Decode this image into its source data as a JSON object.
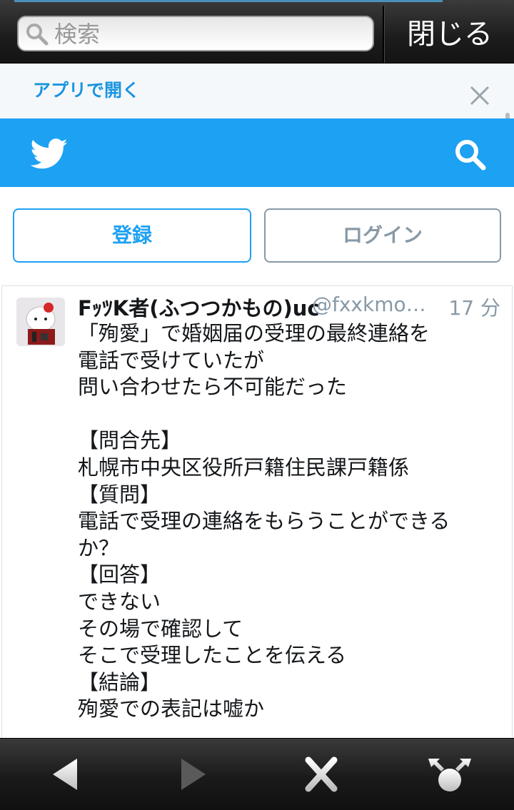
{
  "browser": {
    "search_placeholder": "検索",
    "close_label": "閉じる"
  },
  "banner": {
    "open_in_app": "アプリで開く"
  },
  "twitter": {
    "brand_color": "#1da1f2",
    "signup_label": "登録",
    "login_label": "ログイン"
  },
  "tweet": {
    "author": "FｯﾂK者(ふつつかもの)uc",
    "handle": "@fxxkmon…",
    "time": "17 分",
    "lines": [
      "「殉愛」で婚姻届の受理の最終連絡を",
      "電話で受けていたが",
      "問い合わせたら不可能だった",
      "",
      "【問合先】",
      "札幌市中央区役所戸籍住民課戸籍係",
      "【質問】",
      "電話で受理の連絡をもらうことができる",
      "か？",
      "【回答】",
      "できない",
      "その場で確認して",
      "そこで受理したことを伝える",
      "【結論】",
      "殉愛での表記は嘘か"
    ]
  },
  "icons": {
    "search": "search-icon",
    "close": "close-icon",
    "bird": "twitter-bird-icon",
    "back": "back-arrow-icon",
    "forward": "forward-arrow-icon",
    "stop": "close-tab-icon",
    "share": "share-icon"
  }
}
